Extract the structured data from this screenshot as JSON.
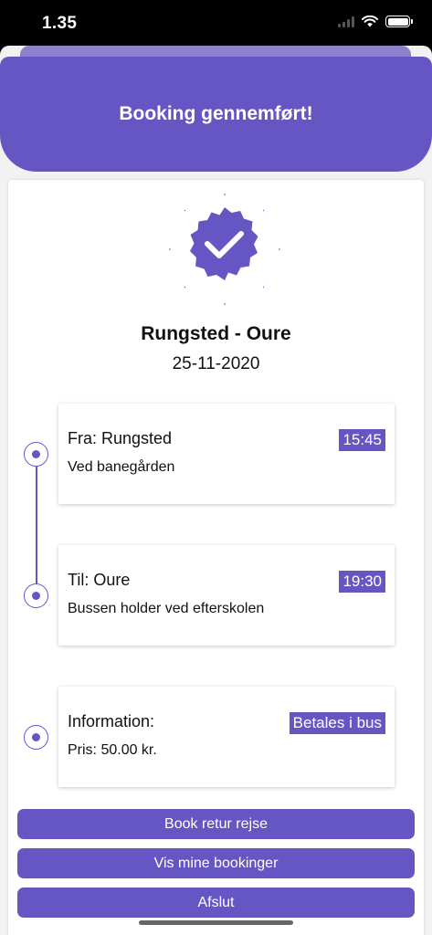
{
  "status_bar": {
    "time": "1.35"
  },
  "header": {
    "title": "Booking gennemført!"
  },
  "route": {
    "title": "Rungsted - Oure",
    "date": "25-11-2020"
  },
  "stops": [
    {
      "title": "Fra: Rungsted",
      "subtitle": "Ved banegården",
      "tag": "15:45"
    },
    {
      "title": "Til: Oure",
      "subtitle": "Bussen holder ved efterskolen",
      "tag": "19:30"
    },
    {
      "title": "Information:",
      "subtitle": "Pris: 50.00 kr.",
      "tag": "Betales i bus"
    }
  ],
  "buttons": {
    "book_return": "Book retur rejse",
    "my_bookings": "Vis mine bookinger",
    "finish": "Afslut"
  },
  "colors": {
    "accent": "#6556c4"
  },
  "icons": {
    "badge": "check-badge-icon",
    "wifi": "wifi-icon",
    "battery": "battery-icon",
    "signal": "signal-icon"
  }
}
